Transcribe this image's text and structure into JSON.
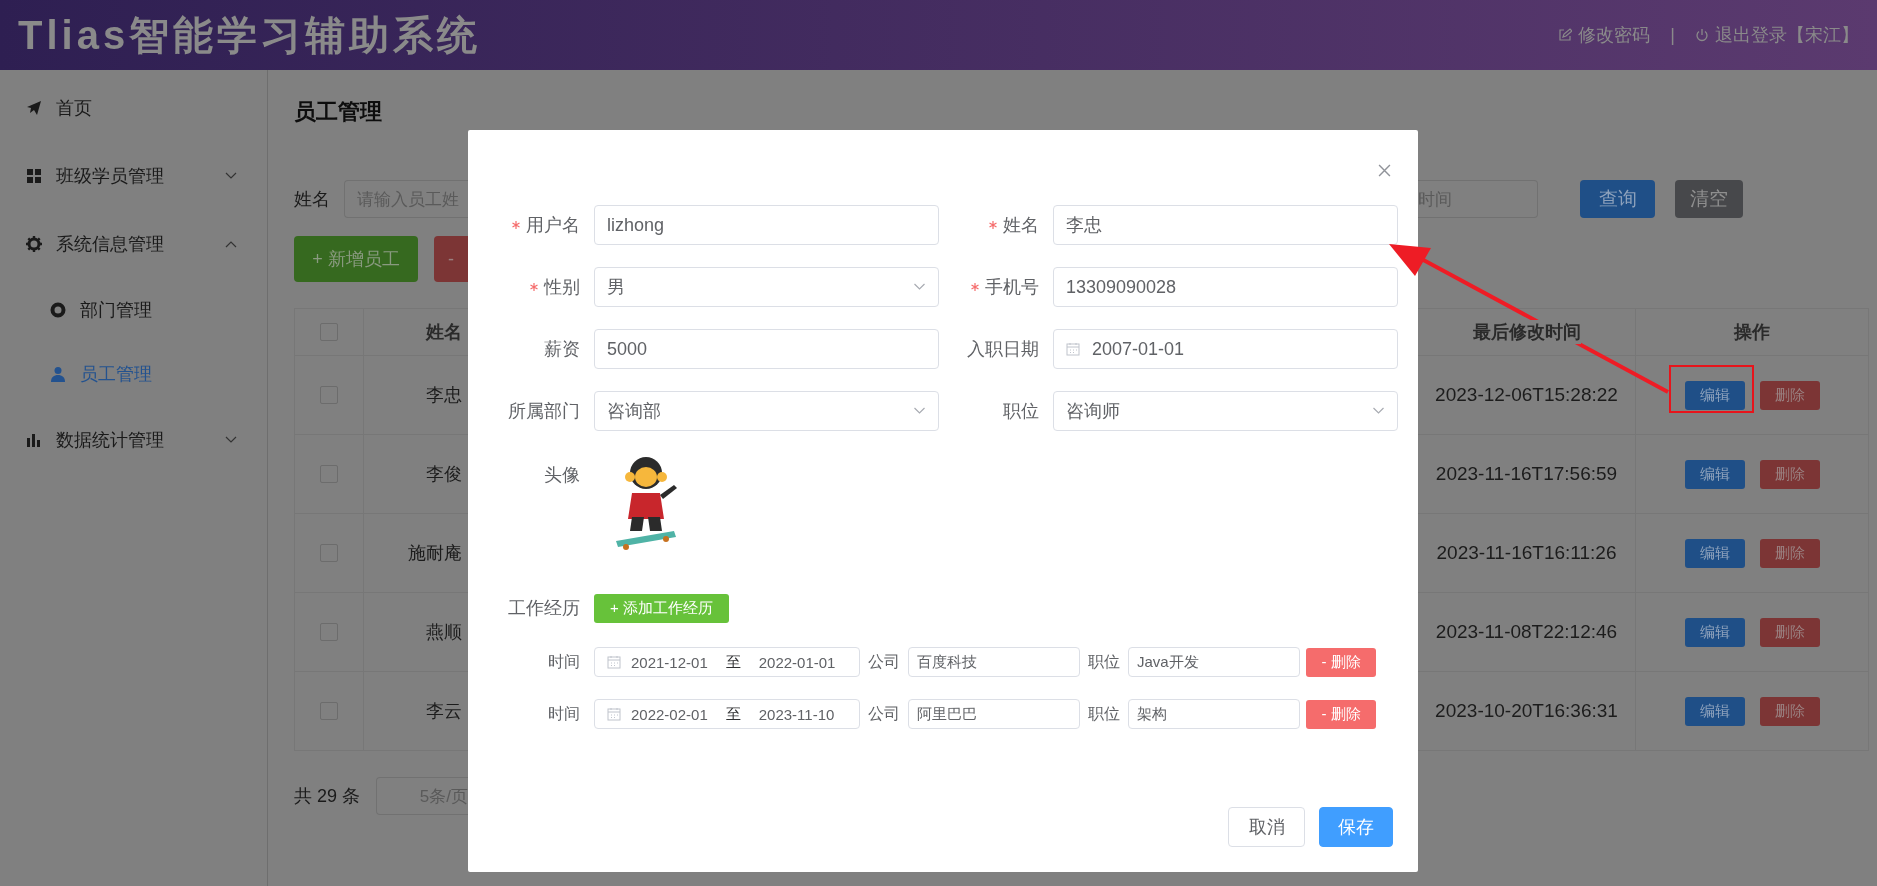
{
  "header": {
    "title": "Tlias智能学习辅助系统",
    "links": [
      "修改密码",
      "退出登录【宋江】"
    ],
    "separator": "|"
  },
  "sidebar": {
    "items": [
      {
        "label": "首页",
        "selected": false
      },
      {
        "label": "班级学员管理",
        "selected": false,
        "expanded": false
      },
      {
        "label": "系统信息管理",
        "selected": false,
        "expanded": true,
        "children": [
          {
            "label": "部门管理",
            "selected": false
          },
          {
            "label": "员工管理",
            "selected": true
          }
        ]
      },
      {
        "label": "数据统计管理",
        "selected": false,
        "expanded": false
      }
    ]
  },
  "page": {
    "title": "员工管理",
    "search": {
      "label": "姓名",
      "placeholder": "请输入员工姓",
      "end_date_placeholder": "时间",
      "query_button": "查询",
      "clear_button": "清空"
    },
    "add_button": "+ 新增员工",
    "batch_delete_button": "-",
    "table": {
      "select_all_checked": false,
      "columns": [
        "姓名",
        "最后修改时间",
        "操作"
      ],
      "rows": [
        {
          "checked": false,
          "name": "李忠",
          "updated": "2023-12-06T15:28:22",
          "edit": "编辑",
          "delete": "删除",
          "highlighted": true
        },
        {
          "checked": false,
          "name": "李俊",
          "updated": "2023-11-16T17:56:59",
          "edit": "编辑",
          "delete": "删除",
          "highlighted": false
        },
        {
          "checked": false,
          "name": "施耐庵",
          "updated": "2023-11-16T16:11:26",
          "edit": "编辑",
          "delete": "删除",
          "highlighted": false
        },
        {
          "checked": false,
          "name": "燕顺",
          "updated": "2023-11-08T22:12:46",
          "edit": "编辑",
          "delete": "删除",
          "highlighted": false
        },
        {
          "checked": false,
          "name": "李云",
          "updated": "2023-10-20T16:36:31",
          "edit": "编辑",
          "delete": "删除",
          "highlighted": false
        }
      ]
    },
    "pagination": {
      "total": "共 29 条",
      "page_size": "5条/页"
    }
  },
  "dialog": {
    "fields": [
      {
        "kind": "text",
        "label": "用户名",
        "required": true,
        "value": "lizhong"
      },
      {
        "kind": "text",
        "label": "姓名",
        "required": true,
        "value": "李忠"
      },
      {
        "kind": "select",
        "label": "性别",
        "required": true,
        "value": "男"
      },
      {
        "kind": "text",
        "label": "手机号",
        "required": true,
        "value": "13309090028"
      },
      {
        "kind": "text",
        "label": "薪资",
        "required": false,
        "value": "5000"
      },
      {
        "kind": "date",
        "label": "入职日期",
        "required": false,
        "value": "2007-01-01"
      },
      {
        "kind": "select",
        "label": "所属部门",
        "required": false,
        "value": "咨询部"
      },
      {
        "kind": "select",
        "label": "职位",
        "required": false,
        "value": "咨询师"
      }
    ],
    "avatar": {
      "label": "头像",
      "kind": "picture"
    },
    "experience": {
      "label": "工作经历",
      "add_button": "+ 添加工作经历",
      "items": [
        {
          "time_label": "时间",
          "start": "2021-12-01",
          "range_separator": "至",
          "end": "2022-01-01",
          "company_label": "公司",
          "company": "百度科技",
          "position_label": "职位",
          "position": "Java开发",
          "delete_button": "- 删除"
        },
        {
          "time_label": "时间",
          "start": "2022-02-01",
          "range_separator": "至",
          "end": "2023-11-10",
          "company_label": "公司",
          "company": "阿里巴巴",
          "position_label": "职位",
          "position": "架构",
          "delete_button": "- 删除"
        }
      ]
    },
    "buttons": {
      "cancel": "取消",
      "save": "保存"
    }
  }
}
